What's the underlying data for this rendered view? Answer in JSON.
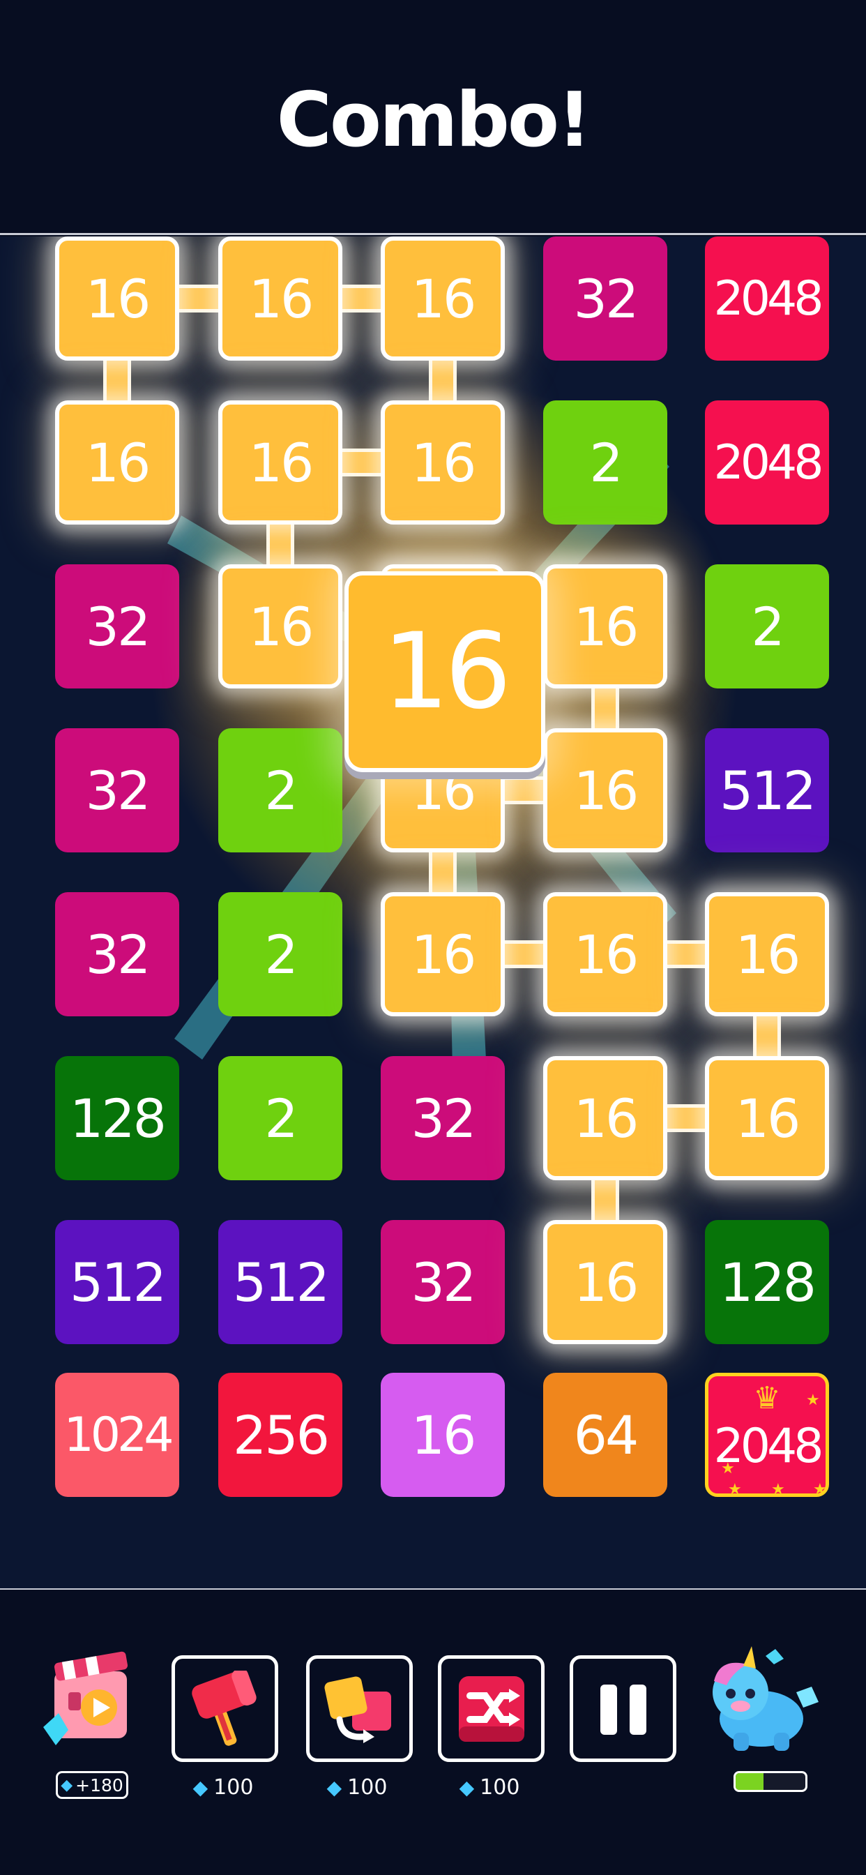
{
  "header": {
    "title": "Combo!"
  },
  "colors": {
    "2": "#6fd10f",
    "16": "#ffbb2e",
    "16_sel": "#ffbf3c",
    "16_pink": "#d65cf0",
    "32": "#cc0c7a",
    "64": "#f0861c",
    "128": "#077409",
    "256": "#f2163d",
    "512": "#5c12c0",
    "1024": "#fb5868",
    "2048": "#f5104f"
  },
  "board": {
    "columns": 5,
    "rows": 8,
    "tiles": [
      [
        {
          "v": "16",
          "sel": true
        },
        {
          "v": "16",
          "sel": true
        },
        {
          "v": "16",
          "sel": true
        },
        {
          "v": "32"
        },
        {
          "v": "2048"
        }
      ],
      [
        {
          "v": "16",
          "sel": true
        },
        {
          "v": "16",
          "sel": true
        },
        {
          "v": "16",
          "sel": true
        },
        {
          "v": "2"
        },
        {
          "v": "2048"
        }
      ],
      [
        {
          "v": "32"
        },
        {
          "v": "16",
          "sel": true
        },
        {
          "v": "",
          "sel": true
        },
        {
          "v": "16",
          "sel": true
        },
        {
          "v": "2"
        }
      ],
      [
        {
          "v": "32"
        },
        {
          "v": "2"
        },
        {
          "v": "16",
          "sel": true
        },
        {
          "v": "16",
          "sel": true
        },
        {
          "v": "512"
        }
      ],
      [
        {
          "v": "32"
        },
        {
          "v": "2"
        },
        {
          "v": "16",
          "sel": true
        },
        {
          "v": "16",
          "sel": true
        },
        {
          "v": "16",
          "sel": true
        }
      ],
      [
        {
          "v": "128"
        },
        {
          "v": "2"
        },
        {
          "v": "32"
        },
        {
          "v": "16",
          "sel": true
        },
        {
          "v": "16",
          "sel": true
        }
      ],
      [
        {
          "v": "512"
        },
        {
          "v": "512"
        },
        {
          "v": "32"
        },
        {
          "v": "16",
          "sel": true
        },
        {
          "v": "128"
        }
      ],
      [
        {
          "v": "1024"
        },
        {
          "v": "256"
        },
        {
          "v": "16",
          "color": "16_pink"
        },
        {
          "v": "64"
        },
        {
          "v": "2048",
          "special": true
        }
      ]
    ],
    "chain": [
      [
        [
          0,
          0
        ],
        [
          0,
          1
        ]
      ],
      [
        [
          0,
          1
        ],
        [
          0,
          2
        ]
      ],
      [
        [
          0,
          0
        ],
        [
          1,
          0
        ]
      ],
      [
        [
          0,
          2
        ],
        [
          1,
          2
        ]
      ],
      [
        [
          1,
          1
        ],
        [
          1,
          2
        ]
      ],
      [
        [
          1,
          1
        ],
        [
          2,
          1
        ]
      ],
      [
        [
          2,
          3
        ],
        [
          3,
          3
        ]
      ],
      [
        [
          3,
          2
        ],
        [
          3,
          3
        ]
      ],
      [
        [
          3,
          2
        ],
        [
          4,
          2
        ]
      ],
      [
        [
          4,
          2
        ],
        [
          4,
          3
        ]
      ],
      [
        [
          4,
          3
        ],
        [
          4,
          4
        ]
      ],
      [
        [
          4,
          4
        ],
        [
          5,
          4
        ]
      ],
      [
        [
          5,
          3
        ],
        [
          5,
          4
        ]
      ],
      [
        [
          5,
          3
        ],
        [
          6,
          3
        ]
      ]
    ]
  },
  "combo_tile": {
    "value": "16"
  },
  "toolbar": {
    "video_reward": "+180",
    "tools": [
      {
        "name": "hammer",
        "cost": "100"
      },
      {
        "name": "swap",
        "cost": "100"
      },
      {
        "name": "shuffle",
        "cost": "100"
      },
      {
        "name": "pause",
        "cost": ""
      }
    ],
    "mascot_progress": 0.4
  }
}
